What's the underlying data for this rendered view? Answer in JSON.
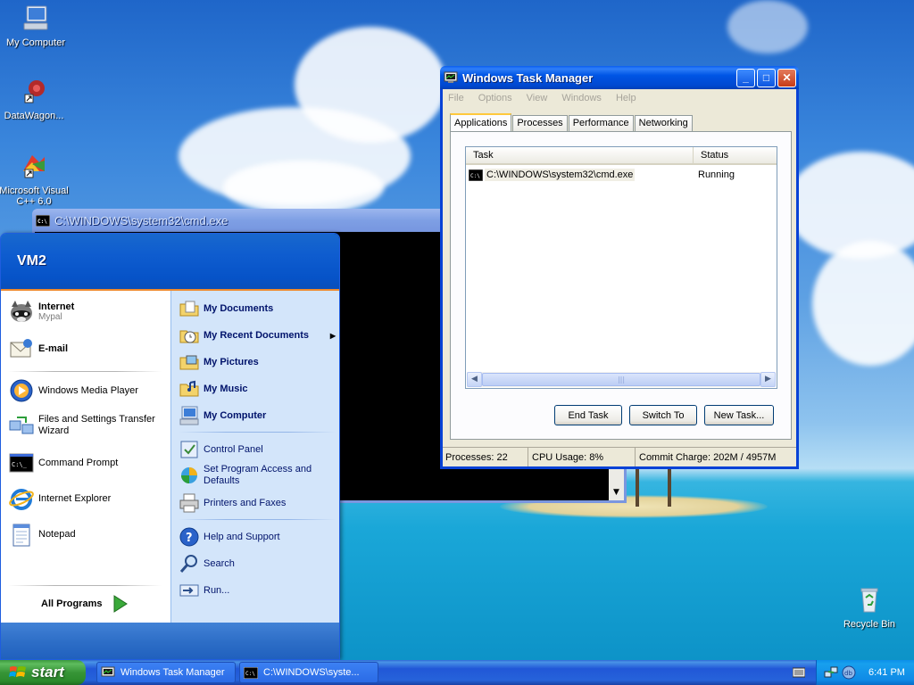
{
  "desktop": {
    "icons": [
      {
        "label": "My Computer"
      },
      {
        "label": "DataWagon..."
      },
      {
        "label": "Microsoft Visual C++ 6.0"
      },
      {
        "label": "Recycle Bin"
      }
    ]
  },
  "cmd_window": {
    "title": "C:\\WINDOWS\\system32\\cmd.exe",
    "scroll_arrow": "▼"
  },
  "task_manager": {
    "title": "Windows Task Manager",
    "menu": [
      "File",
      "Options",
      "View",
      "Windows",
      "Help"
    ],
    "tabs": [
      "Applications",
      "Processes",
      "Performance",
      "Networking"
    ],
    "active_tab": "Applications",
    "columns": {
      "task": "Task",
      "status": "Status"
    },
    "rows": [
      {
        "task": "C:\\WINDOWS\\system32\\cmd.exe",
        "status": "Running"
      }
    ],
    "buttons": {
      "end_task": "End Task",
      "switch_to": "Switch To",
      "new_task": "New Task..."
    },
    "status": {
      "processes": "Processes: 22",
      "cpu": "CPU Usage: 8%",
      "commit": "Commit Charge: 202M / 4957M"
    },
    "controls": {
      "minimize": "_",
      "maximize": "□",
      "close": "✕"
    }
  },
  "start_menu": {
    "user": "VM2",
    "pinned": [
      {
        "label": "Internet",
        "sub": "Mypal"
      },
      {
        "label": "E-mail",
        "sub": ""
      }
    ],
    "recent": [
      {
        "label": "Windows Media Player"
      },
      {
        "label": "Files and Settings Transfer Wizard"
      },
      {
        "label": "Command Prompt"
      },
      {
        "label": "Internet Explorer"
      },
      {
        "label": "Notepad"
      }
    ],
    "all_programs": "All Programs",
    "places": [
      {
        "label": "My Documents"
      },
      {
        "label": "My Recent Documents"
      },
      {
        "label": "My Pictures"
      },
      {
        "label": "My Music"
      },
      {
        "label": "My Computer"
      }
    ],
    "settings": [
      {
        "label": "Control Panel"
      },
      {
        "label": "Set Program Access and Defaults"
      },
      {
        "label": "Printers and Faxes"
      }
    ],
    "tools": [
      {
        "label": "Help and Support"
      },
      {
        "label": "Search"
      },
      {
        "label": "Run..."
      }
    ],
    "submenu_arrow": "▶"
  },
  "taskbar": {
    "start_label": "start",
    "tasks": [
      {
        "label": "Windows Task Manager"
      },
      {
        "label": "C:\\WINDOWS\\syste..."
      }
    ],
    "clock": "6:41 PM"
  },
  "colors": {
    "xp_blue": "#0055e5",
    "start_green": "#379537",
    "start_menu_right": "#d3e5fa"
  }
}
